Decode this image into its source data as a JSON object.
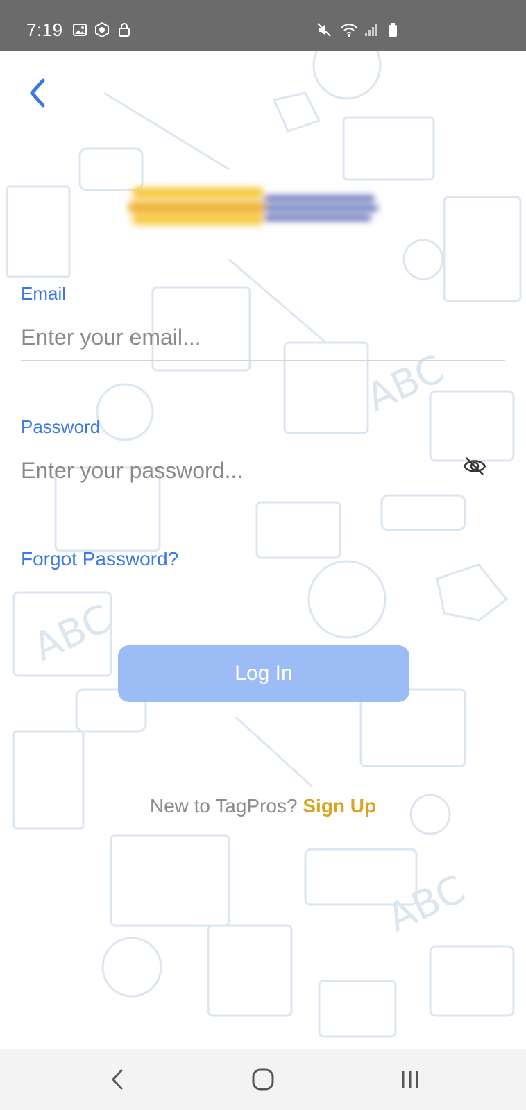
{
  "status_bar": {
    "time": "7:19",
    "left_icons": [
      "image-icon",
      "vpn-shield-icon",
      "lock-icon"
    ],
    "right_icons": [
      "mute-icon",
      "wifi-icon",
      "signal-icon",
      "battery-icon"
    ]
  },
  "header": {
    "back_icon": "chevron-left-icon"
  },
  "logo": {
    "icon": "brand-logo"
  },
  "email": {
    "label": "Email",
    "placeholder": "Enter your email...",
    "value": ""
  },
  "password": {
    "label": "Password",
    "placeholder": "Enter your password...",
    "value": "",
    "toggle_icon": "eye-off-icon"
  },
  "forgot_link": "Forgot Password?",
  "login_button": "Log In",
  "signup": {
    "prompt": "New to TagPros?",
    "link": "Sign Up"
  },
  "nav_bar": {
    "icons": [
      "back-nav-icon",
      "home-nav-icon",
      "recents-nav-icon"
    ]
  },
  "colors": {
    "accent": "#3b78e7",
    "button_bg": "#9bbcf5",
    "signup_link": "#d9a520",
    "status_bar": "#6b6b6b",
    "doodle": "#dbe6f0"
  }
}
